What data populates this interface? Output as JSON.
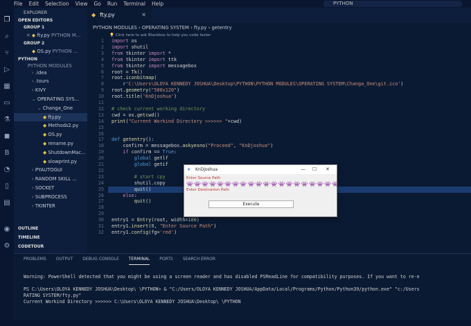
{
  "menu": [
    "File",
    "Edit",
    "Selection",
    "View",
    "Go",
    "Run",
    "Terminal",
    "Help"
  ],
  "command_center": "PYTHON",
  "explorer": {
    "title": "EXPLORER",
    "open_editors": "OPEN EDITORS",
    "group1": "GROUP 1",
    "group1_file": "fty.py",
    "group1_path": "PYTHON M...",
    "group2": "GROUP 2",
    "group2_file": "OS.py",
    "group2_path": "PYTHON ...",
    "root": "PYTHON",
    "root_sub": "PYTHON MODULES",
    "items": [
      ".idea",
      ".tours",
      "KIVY",
      "OPERATING SYS...",
      "Changa_One",
      "fty.py",
      "Methods2.py",
      "OS.py",
      "rename.py",
      "ShutdownMac...",
      "slowprint.py",
      "PYAUTOGUI",
      "RANDOM SKILL ...",
      "SOCKET",
      "SUBPROCESS",
      "TKINTER"
    ],
    "outline": "OUTLINE",
    "timeline": "TIMELINE",
    "codetour": "CODETOUR"
  },
  "tab": "fty.py",
  "breadcrumb": "PYTHON MODULES › OPERATING SYSTEM › fty.py › getentry",
  "hint": "💡 Click here to ask Blackbox to help you code faster",
  "code_lines": [
    "import os",
    "import shutil",
    "from tkinter import *",
    "from tkinter import ttk",
    "from tkinter import messagebox",
    "root = Tk()",
    "root.iconbitmap(",
    "    r'C:\\Users\\OLOYA KENNEDY JOSHUA\\Desktop\\PYTHON\\PYTHON MODULES\\OPERATING SYSTEM\\Changa_One\\git.ico')",
    "root.geometry(\"500x120\")",
    "root.title('KnDjoshua')",
    "",
    "# check current working directory",
    "cwd = os.getcwd()",
    "print(\"Current Workind Directory >>>>>> \"+cwd)",
    "",
    "",
    "def getentry():",
    "    confirm = messagebox.askyesno(\"Proceed\", \"KnDjoshua\")",
    "    if confirm == True:",
    "        global getlf",
    "        global getif",
    "",
    "        # start cpy",
    "        shutil.copy",
    "        quit()",
    "    else:",
    "        quit()",
    "",
    "",
    "entry1 = Entry(root, width=100)",
    "entry1.insert(0, \"Enter Source Path\")",
    "entry1.config(fg='red')"
  ],
  "dialog": {
    "title": "KnDjoshua",
    "source_label": "Enter Source Path",
    "dest_label": "Enter Destination Path",
    "execute": "Execute"
  },
  "panel_tabs": [
    "PROBLEMS",
    "OUTPUT",
    "DEBUG CONSOLE",
    "TERMINAL",
    "PORTS",
    "SEARCH ERROR"
  ],
  "terminal": [
    "Warning: PowerShell detected that you might be using a screen reader and has disabled PSReadLine for compatibility purposes. If you want to re-e",
    "",
    "PS C:\\Users\\OLOYA KENNEDY JOSHUA\\Desktop\\ \\PYTHON> & \"C:/Users/OLOYA KENNEDY JOSHUA/AppData/Local/Programs/Python/Python39/python.exe\" \"c:/Users",
    "RATING SYSTEM/fty.py\"",
    "Current Workind Directory >>>>>> C:\\Users\\OLOYA KENNEDY JOSHUA\\Desktop\\ \\PYTHON"
  ]
}
